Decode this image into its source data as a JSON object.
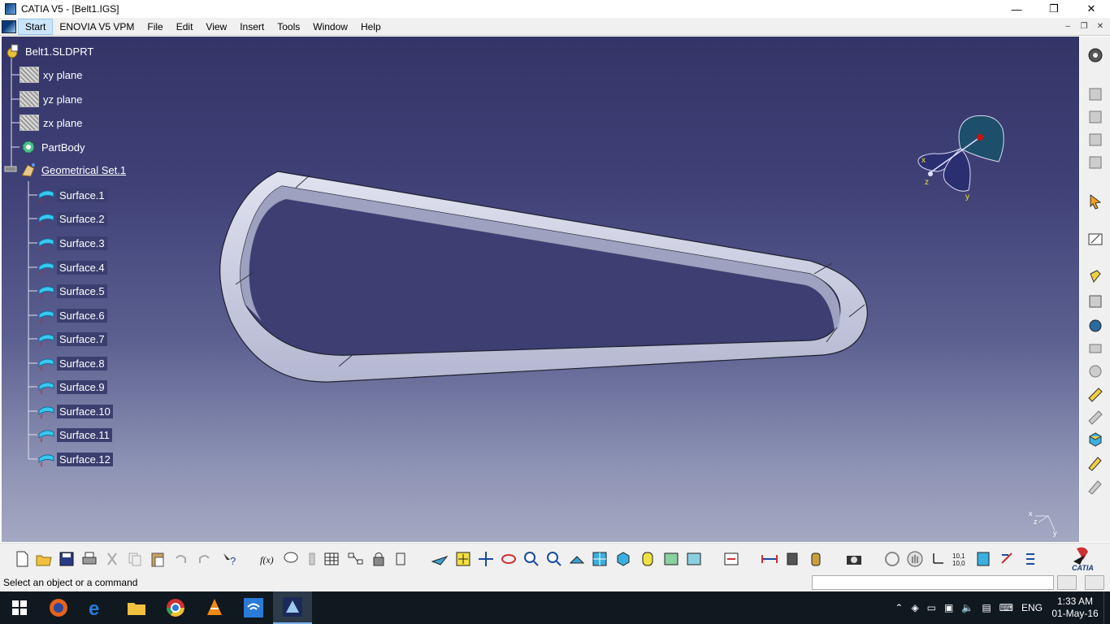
{
  "window": {
    "title": "CATIA V5 - [Belt1.IGS]",
    "minimize": "—",
    "maximize": "❐",
    "close": "✕"
  },
  "menu": {
    "items": [
      "Start",
      "ENOVIA V5 VPM",
      "File",
      "Edit",
      "View",
      "Insert",
      "Tools",
      "Window",
      "Help"
    ],
    "mdi": [
      "–",
      "❐",
      "✕"
    ]
  },
  "tree": {
    "root": "Belt1.SLDPRT",
    "planes": [
      "xy plane",
      "yz plane",
      "zx plane"
    ],
    "body": "PartBody",
    "geoset": "Geometrical Set.1",
    "surfaces": [
      "Surface.1",
      "Surface.2",
      "Surface.3",
      "Surface.4",
      "Surface.5",
      "Surface.6",
      "Surface.7",
      "Surface.8",
      "Surface.9",
      "Surface.10",
      "Surface.11",
      "Surface.12"
    ]
  },
  "compass": {
    "x": "x",
    "y": "y",
    "z": "z"
  },
  "axis_small": {
    "x": "x",
    "y": "y",
    "z": "z"
  },
  "status": {
    "message": "Select an object or a command"
  },
  "taskbar": {
    "lang": "ENG",
    "time": "1:33 AM",
    "date": "01-May-16",
    "apps": [
      "firefox-icon",
      "edge-icon",
      "file-explorer-icon",
      "chrome-icon",
      "vlc-icon",
      "wifi-app-icon",
      "catia-icon"
    ]
  },
  "colors": {
    "viewport_top": "#343467",
    "viewport_bottom": "#a4a8c2",
    "belt": "#c9cbe0"
  }
}
